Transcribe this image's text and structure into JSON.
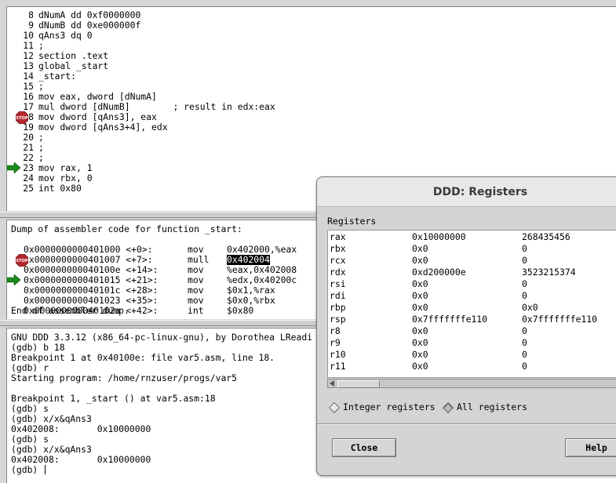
{
  "source": {
    "lines": [
      {
        "n": "8",
        "code": "dNumA dd 0xf0000000"
      },
      {
        "n": "9",
        "code": "dNumB dd 0xe000000f"
      },
      {
        "n": "10",
        "code": "qAns3 dq 0"
      },
      {
        "n": "11",
        "code": ";"
      },
      {
        "n": "12",
        "code": "section .text"
      },
      {
        "n": "13",
        "code": "global _start"
      },
      {
        "n": "14",
        "code": "_start:"
      },
      {
        "n": "15",
        "code": ";"
      },
      {
        "n": "16",
        "code": "mov eax, dword [dNumA]"
      },
      {
        "n": "17",
        "code": "mul dword [dNumB]        ; result in edx:eax"
      },
      {
        "n": "18",
        "code": "mov dword [qAns3], eax"
      },
      {
        "n": "19",
        "code": "mov dword [qAns3+4], edx"
      },
      {
        "n": "20",
        "code": ";"
      },
      {
        "n": "21",
        "code": ";"
      },
      {
        "n": "22",
        "code": ";"
      },
      {
        "n": "23",
        "code": "mov rax, 1"
      },
      {
        "n": "24",
        "code": "mov rbx, 0"
      },
      {
        "n": "25",
        "code": "int 0x80"
      }
    ]
  },
  "assembler": {
    "header": "Dump of assembler code for function _start:",
    "rows": [
      {
        "addr": "0x0000000000401000 <+0>:",
        "mn": "mov",
        "op": "0x402000,%eax"
      },
      {
        "addr": "0x0000000000401007 <+7>:",
        "mn": "mull",
        "op": "0x402004"
      },
      {
        "addr": "0x000000000040100e <+14>:",
        "mn": "mov",
        "op": "%eax,0x402008"
      },
      {
        "addr": "0x0000000000401015 <+21>:",
        "mn": "mov",
        "op": "%edx,0x40200c"
      },
      {
        "addr": "0x000000000040101c <+28>:",
        "mn": "mov",
        "op": "$0x1,%rax"
      },
      {
        "addr": "0x0000000000401023 <+35>:",
        "mn": "mov",
        "op": "$0x0,%rbx"
      },
      {
        "addr": "0x000000000040102a <+42>:",
        "mn": "int",
        "op": "$0x80"
      }
    ],
    "footer": "End of assembler dump."
  },
  "console": {
    "lines": [
      "GNU DDD 3.3.12 (x86_64-pc-linux-gnu), by Dorothea LReadi",
      "(gdb) b 18",
      "Breakpoint 1 at 0x40100e: file var5.asm, line 18.",
      "(gdb) r",
      "Starting program: /home/rnzuser/progs/var5",
      "",
      "Breakpoint 1, _start () at var5.asm:18",
      "(gdb) s",
      "(gdb) x/x&qAns3",
      "0x402008:       0x10000000",
      "(gdb) s",
      "(gdb) x/x&qAns3",
      "0x402008:       0x10000000"
    ],
    "prompt": "(gdb) "
  },
  "registers_dialog": {
    "title": "DDD: Registers",
    "section_label": "Registers",
    "rows": [
      {
        "name": "rax",
        "raw": "0x10000000",
        "natural": "268435456"
      },
      {
        "name": "rbx",
        "raw": "0x0",
        "natural": "0"
      },
      {
        "name": "rcx",
        "raw": "0x0",
        "natural": "0"
      },
      {
        "name": "rdx",
        "raw": "0xd200000e",
        "natural": "3523215374"
      },
      {
        "name": "rsi",
        "raw": "0x0",
        "natural": "0"
      },
      {
        "name": "rdi",
        "raw": "0x0",
        "natural": "0"
      },
      {
        "name": "rbp",
        "raw": "0x0",
        "natural": "0x0"
      },
      {
        "name": "rsp",
        "raw": "0x7fffffffe110",
        "natural": "0x7fffffffe110"
      },
      {
        "name": "r8",
        "raw": "0x0",
        "natural": "0"
      },
      {
        "name": "r9",
        "raw": "0x0",
        "natural": "0"
      },
      {
        "name": "r10",
        "raw": "0x0",
        "natural": "0"
      },
      {
        "name": "r11",
        "raw": "0x0",
        "natural": "0"
      }
    ],
    "radio_integer": "Integer registers",
    "radio_all": "All registers",
    "close_label": "Close",
    "help_label": "Help"
  },
  "icons": {
    "breakpoint": "stop-sign-icon",
    "execution": "green-arrow-icon"
  },
  "colors": {
    "stop_sign": "#b3282d",
    "exec_arrow": "#1a8a1a"
  }
}
